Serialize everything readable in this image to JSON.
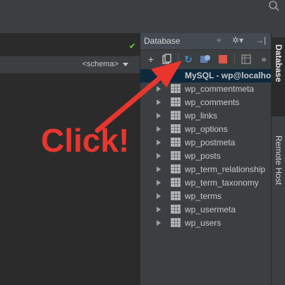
{
  "editor": {
    "schema_selector": "<schema>"
  },
  "database_panel": {
    "title": "Database",
    "connection_label": "MySQL - wp@localhost",
    "tables": [
      "wp_commentmeta",
      "wp_comments",
      "wp_links",
      "wp_options",
      "wp_postmeta",
      "wp_posts",
      "wp_term_relationship",
      "wp_term_taxonomy",
      "wp_terms",
      "wp_usermeta",
      "wp_users"
    ]
  },
  "side_tabs": [
    "Database",
    "Remote Host"
  ],
  "annotation": {
    "text": "Click!",
    "color": "#e8362e"
  },
  "icons": {
    "search": "search-icon",
    "add": "add-icon",
    "copy_properties": "copy-icon",
    "refresh": "refresh-icon",
    "settings": "settings-icon",
    "stop": "stop-icon",
    "table": "table-icon"
  },
  "colors": {
    "selected_row": "#0d293e",
    "panel_bg": "#3c3f41",
    "editor_bg": "#2b2b2b",
    "check": "#5fb63b"
  }
}
